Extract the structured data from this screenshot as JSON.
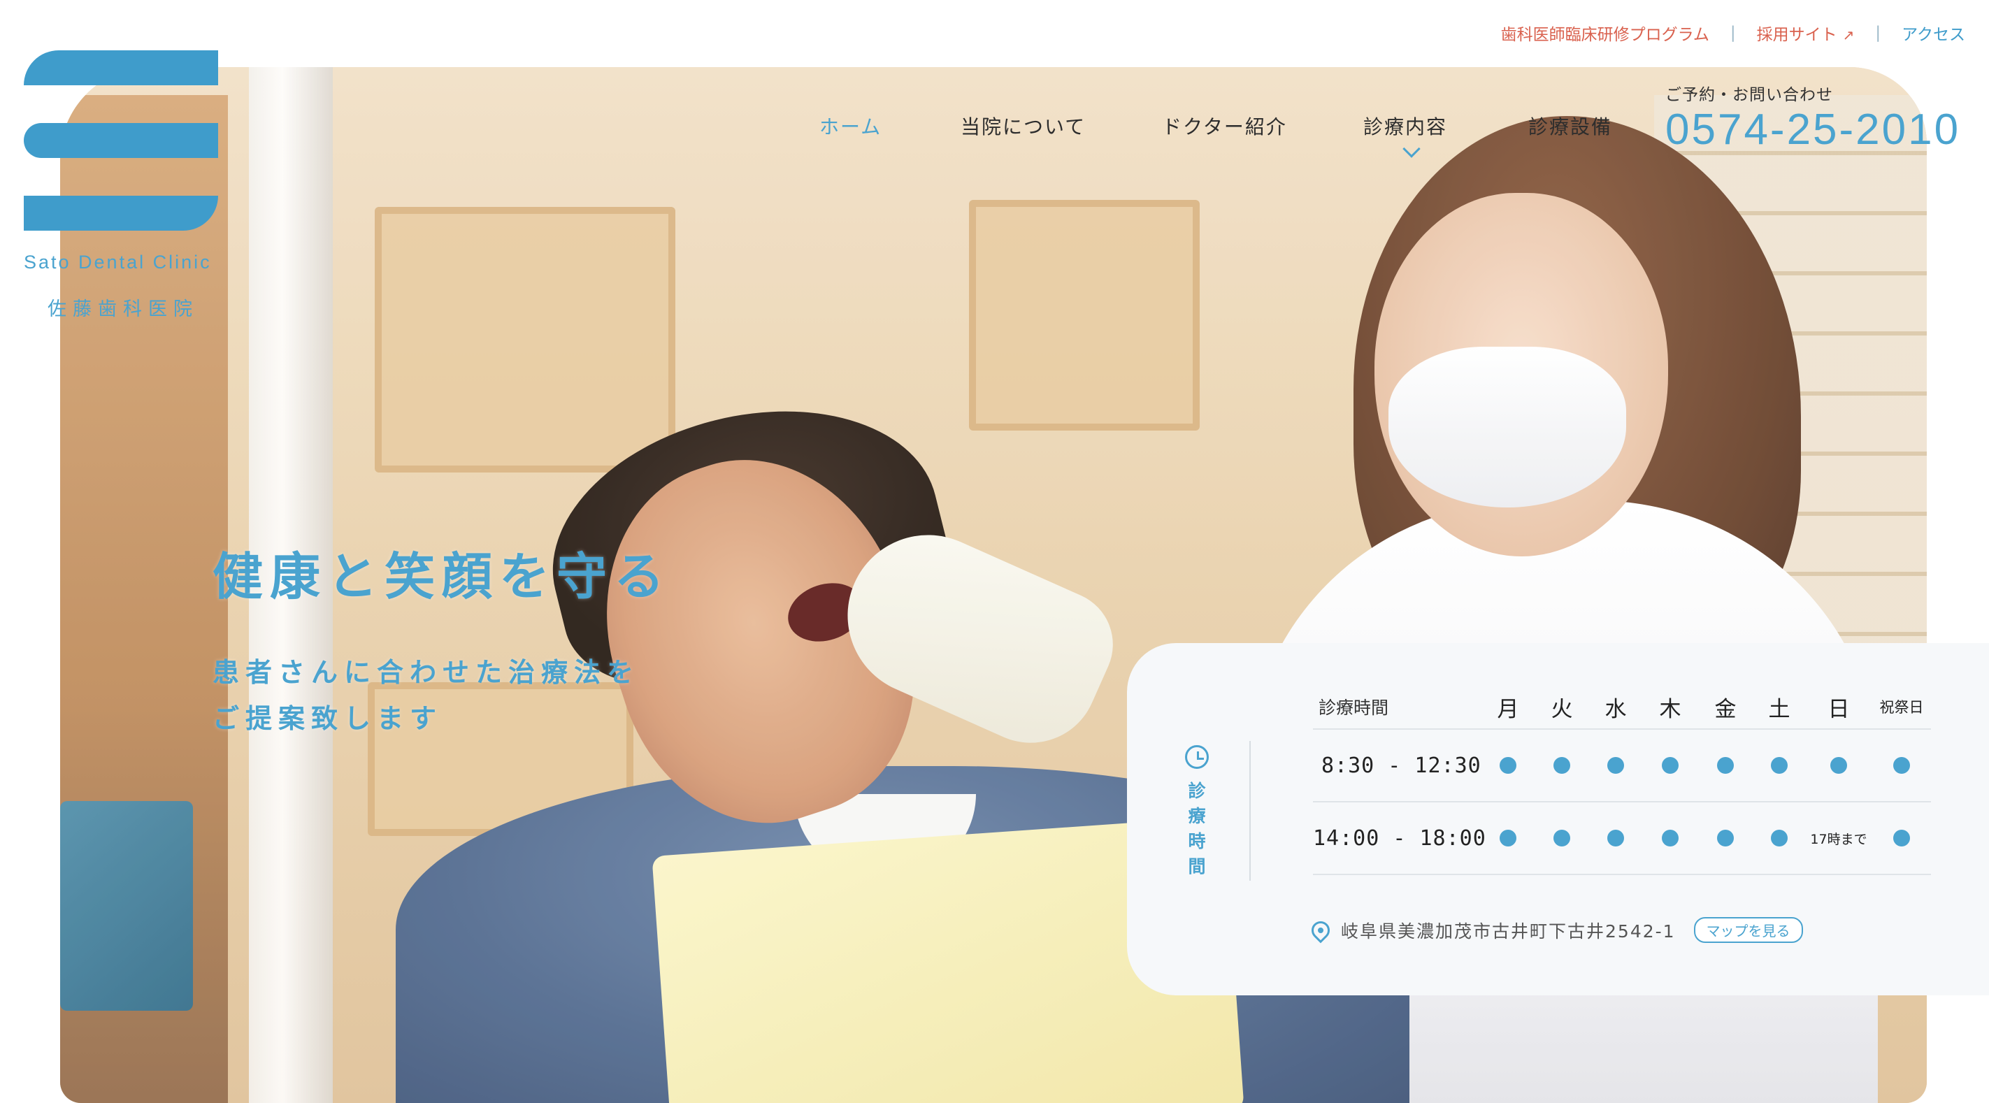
{
  "brand": {
    "name_en": "Sato Dental Clinic",
    "name_ja": "佐藤歯科医院",
    "color": "#3f9ccb"
  },
  "utility_links": [
    {
      "label": "歯科医師臨床研修プログラム",
      "icon": ""
    },
    {
      "label": "採用サイト",
      "icon": "external-link-icon"
    },
    {
      "label": "アクセス",
      "icon": ""
    }
  ],
  "nav": {
    "items": [
      "ホーム",
      "当院について",
      "ドクター紹介",
      "診療内容",
      "診療設備"
    ],
    "active": "ホーム"
  },
  "contact": {
    "label": "ご予約・お問い合わせ",
    "phone": "0574-25-2010"
  },
  "hero": {
    "headline": "健康と笑顔を守る",
    "sub_line1": "患者さんに合わせた治療法を",
    "sub_line2": "ご提案致します"
  },
  "hours": {
    "side_label": [
      "診",
      "療",
      "時",
      "間"
    ],
    "header": "診療時間",
    "days": [
      "月",
      "火",
      "水",
      "木",
      "金",
      "土",
      "日",
      "祝祭日"
    ],
    "rows": [
      {
        "time": "8:30 - 12:30",
        "cells": [
          "●",
          "●",
          "●",
          "●",
          "●",
          "●",
          "●",
          "●"
        ]
      },
      {
        "time": "14:00 - 18:00",
        "cells": [
          "●",
          "●",
          "●",
          "●",
          "●",
          "●",
          "17時まで",
          "●"
        ]
      }
    ],
    "address": "岐阜県美濃加茂市古井町下古井2542-1",
    "map_button": "マップを見る"
  }
}
